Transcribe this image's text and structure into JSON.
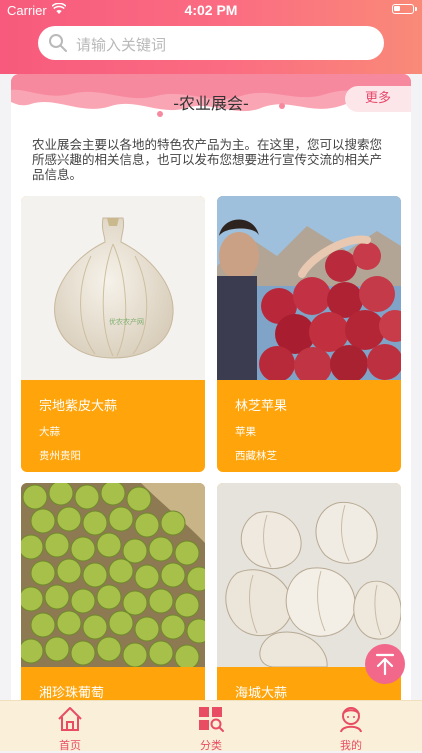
{
  "status_bar": {
    "carrier": "Carrier",
    "time": "4:02 PM"
  },
  "search": {
    "placeholder": "请输入关键词"
  },
  "section": {
    "title": "-农业展会-",
    "more_label": "更多",
    "description": "农业展会主要以各地的特色农产品为主。在这里，您可以搜索您所感兴趣的相关信息，也可以发布您想要进行宣传交流的相关产品信息。"
  },
  "products": [
    {
      "name": "宗地紫皮大蒜",
      "category": "大蒜",
      "location": "贵州贵阳",
      "watermark": "优农农产网"
    },
    {
      "name": "林芝苹果",
      "category": "苹果",
      "location": "西藏林芝"
    },
    {
      "name": "湘珍珠葡萄",
      "category": "",
      "location": ""
    },
    {
      "name": "海城大蒜",
      "category": "",
      "location": ""
    }
  ],
  "tabbar": {
    "items": [
      {
        "label": "首页",
        "icon": "home-icon"
      },
      {
        "label": "分类",
        "icon": "category-icon"
      },
      {
        "label": "我的",
        "icon": "profile-icon"
      }
    ]
  },
  "colors": {
    "header_start": "#f75a7c",
    "header_end": "#f98a78",
    "card_info": "#ffa40a",
    "tab_active": "#e84d64",
    "back_to_top": "#f2688b"
  }
}
